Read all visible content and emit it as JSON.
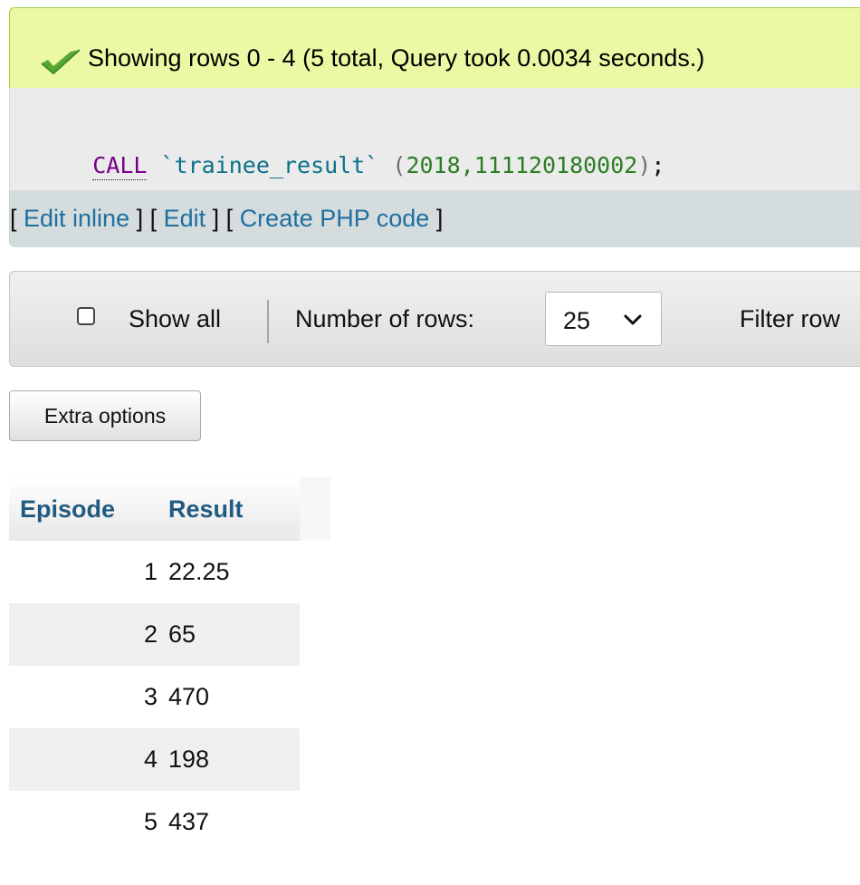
{
  "message": {
    "text": "Showing rows 0 - 4 (5 total, Query took 0.0034 seconds.)",
    "icon": "check-icon",
    "colors": {
      "background": "#ebf8a4",
      "border": "#a2d246",
      "icon": "#5aa832"
    }
  },
  "sql": {
    "keyword": "CALL",
    "space_1": " ",
    "table": "`trainee_result`",
    "space_2": " ",
    "open_paren": "(",
    "arguments": "2018,111120180002",
    "close_paren": ")",
    "terminator": ";"
  },
  "tools": {
    "brackets": {
      "open_1": "[ ",
      "close_1": " ]",
      "open_2": " [ ",
      "close_2": " ]",
      "open_3": " [ ",
      "close_3": " ]"
    },
    "links": [
      "Edit inline",
      "Edit",
      "Create PHP code"
    ]
  },
  "navigation": {
    "show_all_label": "Show all",
    "show_all_checked": false,
    "rows_label": "Number of rows:",
    "rows_value": "25",
    "filter_label": "Filter row"
  },
  "actions": {
    "extra_options_label": "Extra options"
  },
  "table": {
    "columns": [
      "Episode",
      "Result"
    ],
    "rows": [
      {
        "episode": "1",
        "result": "22.25"
      },
      {
        "episode": "2",
        "result": "65"
      },
      {
        "episode": "3",
        "result": "470"
      },
      {
        "episode": "4",
        "result": "198"
      },
      {
        "episode": "5",
        "result": "437"
      }
    ]
  }
}
